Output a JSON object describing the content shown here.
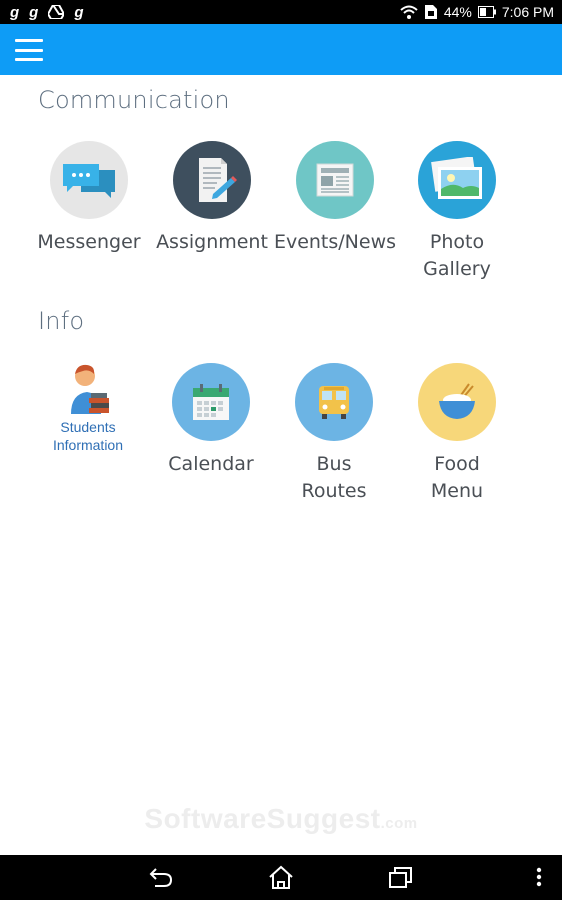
{
  "status_bar": {
    "left_icons": [
      "g",
      "g",
      "g"
    ],
    "battery": "44%",
    "time": "7:06 PM"
  },
  "app_bar": {
    "color": "#0e9cf6",
    "menu_icon": "hamburger-icon"
  },
  "sections": [
    {
      "title": "Communication",
      "items": [
        {
          "label": "Messenger",
          "icon": "chat-bubbles-icon",
          "bg": "#e6e6e6"
        },
        {
          "label": "Assignment",
          "icon": "document-pencil-icon",
          "bg": "#3e4f5e"
        },
        {
          "label": "Events/News",
          "icon": "newspaper-icon",
          "bg": "#6fc6c6"
        },
        {
          "label": "Photo",
          "label2": "Gallery",
          "icon": "photos-icon",
          "bg": "#2aa3d8"
        }
      ]
    },
    {
      "title": "Info",
      "items": [
        {
          "label": "Students",
          "label2": "Information",
          "icon": "student-books-icon"
        },
        {
          "label": "Calendar",
          "icon": "calendar-icon",
          "bg": "#6cb4e4"
        },
        {
          "label": "Bus",
          "label2": "Routes",
          "icon": "bus-icon",
          "bg": "#6cb4e4"
        },
        {
          "label": "Food",
          "label2": "Menu",
          "icon": "food-bowl-icon",
          "bg": "#f7d77a"
        }
      ]
    }
  ],
  "watermark": {
    "main": "SoftwareSuggest",
    "suffix": ".com"
  },
  "nav_bar": {
    "icons": [
      "back-icon",
      "home-icon",
      "recents-icon",
      "more-vert-icon"
    ]
  }
}
